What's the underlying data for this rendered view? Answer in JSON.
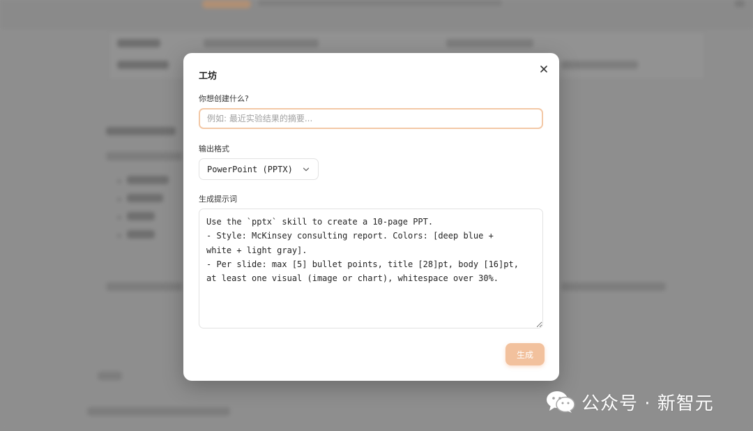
{
  "modal": {
    "title": "工坊",
    "close_icon": "close-icon",
    "prompt_label": "你想创建什么?",
    "prompt_placeholder": "例如: 最近实验结果的摘要...",
    "format_label": "输出格式",
    "format_value": "PowerPoint (PPTX)",
    "format_chevron_icon": "chevron-down-icon",
    "generation_prompt_label": "生成提示词",
    "generation_prompt_text": "Use the `pptx` skill to create a 10-page PPT.\n- Style: McKinsey consulting report. Colors: [deep blue +\nwhite + light gray].\n- Per slide: max [5] bullet points, title [28]pt, body [16]pt,\nat least one visual (image or chart), whitespace over 30%.",
    "generate_label": "生成"
  },
  "watermark": {
    "icon": "wechat-icon",
    "text": "公众号 · 新智元"
  },
  "colors": {
    "accent": "#f2c19d",
    "input_focus_border": "#f3c8a6",
    "overlay": "#8e8e8e"
  }
}
